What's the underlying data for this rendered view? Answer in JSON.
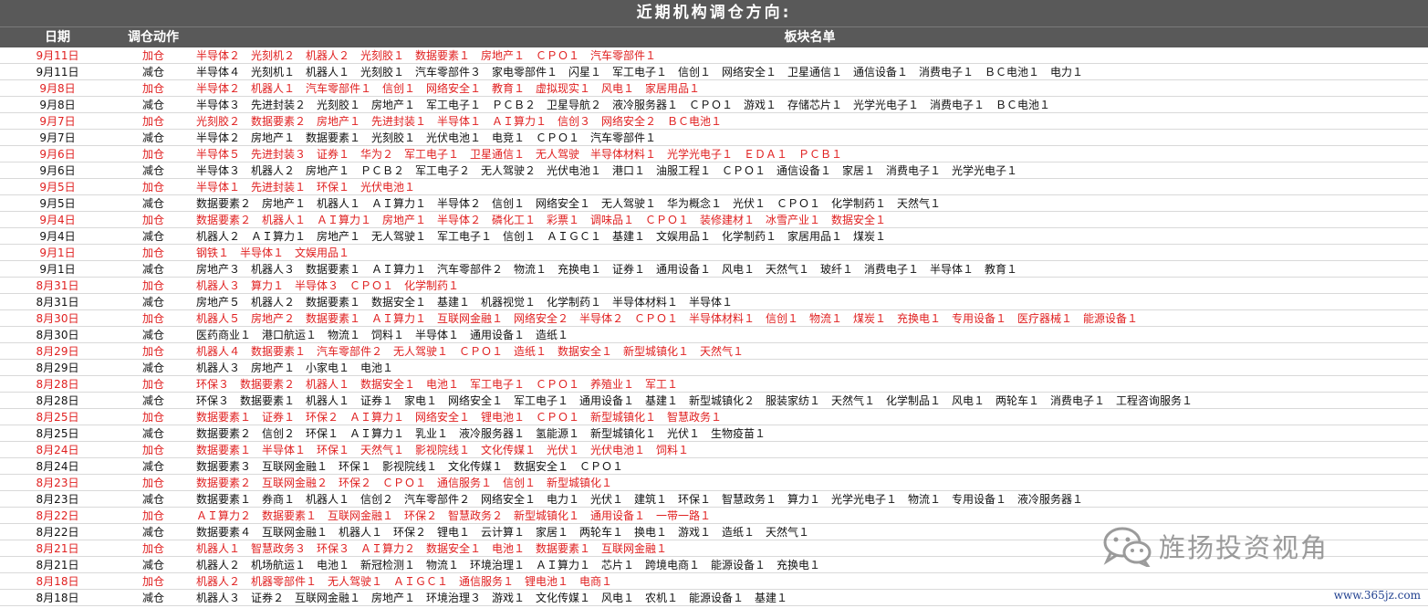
{
  "title": "近期机构调仓方向:",
  "headers": {
    "date": "日期",
    "action": "调仓动作",
    "sectors": "板块名单"
  },
  "rows": [
    {
      "date": "9月11日",
      "action": "加仓",
      "type": "add",
      "sectors": "半导体２　光刻机２　机器人２　光刻胶１　数据要素１　房地产１　ＣＰＯ１　汽车零部件１"
    },
    {
      "date": "9月11日",
      "action": "减仓",
      "type": "cut",
      "sectors": "半导体４　光刻机１　机器人１　光刻胶１　汽车零部件３　家电零部件１　闪星１　军工电子１　信创１　网络安全１　卫星通信１　通信设备１　消费电子１　ＢＣ电池１　电力１"
    },
    {
      "date": "9月8日",
      "action": "加仓",
      "type": "add",
      "sectors": "半导体２　机器人１　汽车零部件１　信创１　网络安全１　教育１　虚拟现实１　风电１　家居用品１"
    },
    {
      "date": "9月8日",
      "action": "减仓",
      "type": "cut",
      "sectors": "半导体３　先进封装２　光刻胶１　房地产１　军工电子１　ＰＣＢ２　卫星导航２　液冷服务器１　ＣＰＯ１　游戏１　存储芯片１　光学光电子１　消费电子１　ＢＣ电池１"
    },
    {
      "date": "9月7日",
      "action": "加仓",
      "type": "add",
      "sectors": "光刻胶２　数据要素２　房地产１　先进封装１　半导体１　ＡＩ算力１　信创３　网络安全２　ＢＣ电池１"
    },
    {
      "date": "9月7日",
      "action": "减仓",
      "type": "cut",
      "sectors": "半导体２　房地产１　数据要素１　光刻胶１　光伏电池１　电竞１　ＣＰＯ１　汽车零部件１"
    },
    {
      "date": "9月6日",
      "action": "加仓",
      "type": "add",
      "sectors": "半导体５　先进封装３　证券１　华为２　军工电子１　卫星通信１　无人驾驶　半导体材料１　光学光电子１　ＥＤＡ１　ＰＣＢ１"
    },
    {
      "date": "9月6日",
      "action": "减仓",
      "type": "cut",
      "sectors": "半导体３　机器人２　房地产１　ＰＣＢ２　军工电子２　无人驾驶２　光伏电池１　港口１　油服工程１　ＣＰＯ１　通信设备１　家居１　消费电子１　光学光电子１"
    },
    {
      "date": "9月5日",
      "action": "加仓",
      "type": "add",
      "sectors": "半导体１　先进封装１　环保１　光伏电池１"
    },
    {
      "date": "9月5日",
      "action": "减仓",
      "type": "cut",
      "sectors": "数据要素２　房地产１　机器人１　ＡＩ算力１　半导体２　信创１　网络安全１　无人驾驶１　华为概念１　光伏１　ＣＰＯ１　化学制药１　天然气１"
    },
    {
      "date": "9月4日",
      "action": "加仓",
      "type": "add",
      "sectors": "数据要素２　机器人１　ＡＩ算力１　房地产１　半导体２　磷化工１　彩票１　调味品１　ＣＰＯ１　装修建材１　冰雪产业１　数据安全１"
    },
    {
      "date": "9月4日",
      "action": "减仓",
      "type": "cut",
      "sectors": "机器人２　ＡＩ算力１　房地产１　无人驾驶１　军工电子１　信创１　ＡＩＧＣ１　基建１　文娱用品１　化学制药１　家居用品１　煤炭１"
    },
    {
      "date": "9月1日",
      "action": "加仓",
      "type": "add",
      "sectors": "钢铁１　半导体１　文娱用品１"
    },
    {
      "date": "9月1日",
      "action": "减仓",
      "type": "cut",
      "sectors": "房地产３　机器人３　数据要素１　ＡＩ算力１　汽车零部件２　物流１　充换电１　证券１　通用设备１　风电１　天然气１　玻纤１　消费电子１　半导体１　教育１"
    },
    {
      "date": "8月31日",
      "action": "加仓",
      "type": "add",
      "sectors": "机器人３　算力１　半导体３　ＣＰＯ１　化学制药１"
    },
    {
      "date": "8月31日",
      "action": "减仓",
      "type": "cut",
      "sectors": "房地产５　机器人２　数据要素１　数据安全１　基建１　机器视觉１　化学制药１　半导体材料１　半导体１"
    },
    {
      "date": "8月30日",
      "action": "加仓",
      "type": "add",
      "sectors": "机器人５　房地产２　数据要素１　ＡＩ算力１　互联网金融１　网络安全２　半导体２　ＣＰＯ１　半导体材料１　信创１　物流１　煤炭１　充换电１　专用设备１　医疗器械１　能源设备１"
    },
    {
      "date": "8月30日",
      "action": "减仓",
      "type": "cut",
      "sectors": "医药商业１　港口航运１　物流１　饲料１　半导体１　通用设备１　造纸１"
    },
    {
      "date": "8月29日",
      "action": "加仓",
      "type": "add",
      "sectors": "机器人４　数据要素１　汽车零部件２　无人驾驶１　ＣＰＯ１　造纸１　数据安全１　新型城镇化１　天然气１"
    },
    {
      "date": "8月29日",
      "action": "减仓",
      "type": "cut",
      "sectors": "机器人３　房地产１　小家电１　电池１"
    },
    {
      "date": "8月28日",
      "action": "加仓",
      "type": "add",
      "sectors": "环保３　数据要素２　机器人１　数据安全１　电池１　军工电子１　ＣＰＯ１　养殖业１　军工１"
    },
    {
      "date": "8月28日",
      "action": "减仓",
      "type": "cut",
      "sectors": "环保３　数据要素１　机器人１　证券１　家电１　网络安全１　军工电子１　通用设备１　基建１　新型城镇化２　服装家纺１　天然气１　化学制品１　风电１　两轮车１　消费电子１　工程咨询服务１"
    },
    {
      "date": "8月25日",
      "action": "加仓",
      "type": "add",
      "sectors": "数据要素１　证券１　环保２　ＡＩ算力１　网络安全１　锂电池１　ＣＰＯ１　新型城镇化１　智慧政务１"
    },
    {
      "date": "8月25日",
      "action": "减仓",
      "type": "cut",
      "sectors": "数据要素２　信创２　环保１　ＡＩ算力１　乳业１　液冷服务器１　氢能源１　新型城镇化１　光伏１　生物疫苗１"
    },
    {
      "date": "8月24日",
      "action": "加仓",
      "type": "add",
      "sectors": "数据要素１　半导体１　环保１　天然气１　影视院线１　文化传媒１　光伏１　光伏电池１　饲料１"
    },
    {
      "date": "8月24日",
      "action": "减仓",
      "type": "cut",
      "sectors": "数据要素３　互联网金融１　环保１　影视院线１　文化传媒１　数据安全１　ＣＰＯ１"
    },
    {
      "date": "8月23日",
      "action": "加仓",
      "type": "add",
      "sectors": "数据要素２　互联网金融２　环保２　ＣＰＯ１　通信服务１　信创１　新型城镇化１"
    },
    {
      "date": "8月23日",
      "action": "减仓",
      "type": "cut",
      "sectors": "数据要素１　券商１　机器人１　信创２　汽车零部件２　网络安全１　电力１　光伏１　建筑１　环保１　智慧政务１　算力１　光学光电子１　物流１　专用设备１　液冷服务器１"
    },
    {
      "date": "8月22日",
      "action": "加仓",
      "type": "add",
      "sectors": "ＡＩ算力２　数据要素１　互联网金融１　环保２　智慧政务２　新型城镇化１　通用设备１　一带一路１"
    },
    {
      "date": "8月22日",
      "action": "减仓",
      "type": "cut",
      "sectors": "数据要素４　互联网金融１　机器人１　环保２　锂电１　云计算１　家居１　两轮车１　换电１　游戏１　造纸１　天然气１"
    },
    {
      "date": "8月21日",
      "action": "加仓",
      "type": "add",
      "sectors": "机器人１　智慧政务３　环保３　ＡＩ算力２　数据安全１　电池１　数据要素１　互联网金融１"
    },
    {
      "date": "8月21日",
      "action": "减仓",
      "type": "cut",
      "sectors": "机器人２　机场航运１　电池１　新冠检测１　物流１　环境治理１　ＡＩ算力１　芯片１　跨境电商１　能源设备１　充换电１"
    },
    {
      "date": "8月18日",
      "action": "加仓",
      "type": "add",
      "sectors": "机器人２　机器零部件１　无人驾驶１　ＡＩＧＣ１　通信服务１　锂电池１　电商１"
    },
    {
      "date": "8月18日",
      "action": "减仓",
      "type": "cut",
      "sectors": "机器人３　证券２　互联网金融１　房地产１　环境治理３　游戏１　文化传媒１　风电１　农机１　能源设备１　基建１"
    }
  ],
  "watermark": {
    "text": "旌扬投资视角",
    "icon": "wechat-icon"
  },
  "url": "www.365jz.com",
  "colors": {
    "header_bg": "#595959",
    "add": "#e02020",
    "cut": "#111111"
  }
}
